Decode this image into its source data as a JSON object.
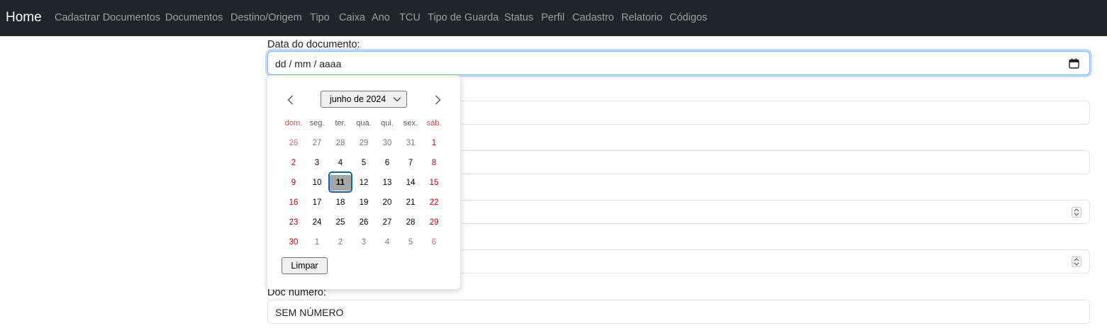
{
  "navbar": {
    "brand": "Home",
    "links": [
      "Cadastrar Documentos",
      "Documentos",
      "Destino/Origem",
      "Tipo",
      "Caixa",
      "Ano",
      "TCU",
      "Tipo de Guarda",
      "Status",
      "Perfil",
      "Cadastro",
      "Relatorio",
      "Códigos"
    ]
  },
  "form": {
    "date_label": "Data do documento:",
    "date_placeholder": "dd / mm / aaaa",
    "doc_number_label": "Doc numero:",
    "doc_number_value": "SEM NÚMERO"
  },
  "calendar": {
    "month_label": "junho de 2024",
    "weekdays": [
      "dom.",
      "seg.",
      "ter.",
      "qua.",
      "qui.",
      "sex.",
      "sáb."
    ],
    "weeks": [
      [
        "26",
        "27",
        "28",
        "29",
        "30",
        "31",
        "1"
      ],
      [
        "2",
        "3",
        "4",
        "5",
        "6",
        "7",
        "8"
      ],
      [
        "9",
        "10",
        "11",
        "12",
        "13",
        "14",
        "15"
      ],
      [
        "16",
        "17",
        "18",
        "19",
        "20",
        "21",
        "22"
      ],
      [
        "23",
        "24",
        "25",
        "26",
        "27",
        "28",
        "29"
      ],
      [
        "30",
        "1",
        "2",
        "3",
        "4",
        "5",
        "6"
      ]
    ],
    "selected_day": "11",
    "clear_label": "Limpar"
  },
  "colors": {
    "navbar_bg": "#212529",
    "weekend_red": "#c00000",
    "focus_ring": "#1264b0"
  },
  "icons": [
    "calendar-icon",
    "chevron-left-icon",
    "chevron-right-icon",
    "chevron-down-icon",
    "spinner-icon"
  ]
}
